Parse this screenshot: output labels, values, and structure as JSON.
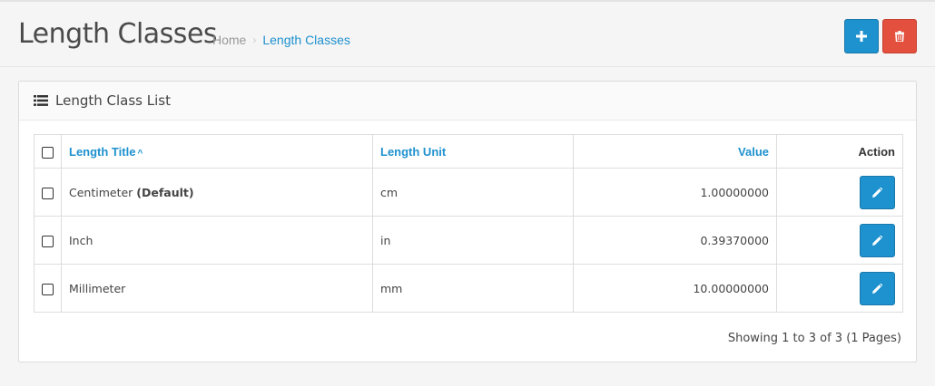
{
  "header": {
    "title": "Length Classes",
    "breadcrumb": {
      "home": "Home",
      "separator": "›",
      "current": "Length Classes"
    },
    "add_icon": "plus-icon",
    "delete_icon": "trash-icon"
  },
  "panel": {
    "icon": "list-icon",
    "title": "Length Class List"
  },
  "table": {
    "columns": {
      "title": "Length Title",
      "unit": "Length Unit",
      "value": "Value",
      "action": "Action"
    },
    "sort_indicator": "^",
    "rows": [
      {
        "title": "Centimeter",
        "suffix": "(Default)",
        "unit": "cm",
        "value": "1.00000000"
      },
      {
        "title": "Inch",
        "suffix": "",
        "unit": "in",
        "value": "0.39370000"
      },
      {
        "title": "Millimeter",
        "suffix": "",
        "unit": "mm",
        "value": "10.00000000"
      }
    ]
  },
  "pagination": {
    "results": "Showing 1 to 3 of 3 (1 Pages)"
  },
  "colors": {
    "primary": "#1e91cf",
    "danger": "#e3503e"
  }
}
